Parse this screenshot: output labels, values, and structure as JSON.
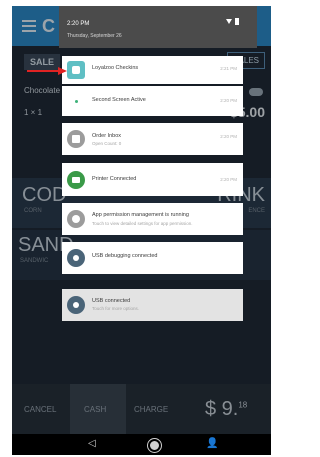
{
  "app": {
    "letter": "C",
    "more": "⋮",
    "sale_label": "SALE",
    "sales_button": "SALES",
    "item_name": "Chocolate",
    "qty_text": "1  ×  1",
    "price": "$5.00",
    "tile_1": "COD",
    "tile_1_sub": "CORN",
    "tile_2": "SAND",
    "tile_2_sub": "SANDWIC",
    "tile_3": "RINK",
    "tile_3_sub": "ENCE",
    "bottom": {
      "cancel": "CANCEL",
      "cash": "CASH",
      "charge": "CHARGE",
      "total_main": "$ 9.",
      "total_cents": "18"
    }
  },
  "nav": {
    "back": "◁",
    "person": "👤"
  },
  "shade": {
    "time": "2:20 PM",
    "date": "Thursday, September 26",
    "notifications": [
      {
        "title": "Loyalzoo Checkins",
        "subtitle": "",
        "time": "2:21 PM",
        "icon_color": "#5fbfc4",
        "icon": "loyalty-app-icon"
      },
      {
        "title": "Second Screen Active",
        "subtitle": "",
        "time": "2:20 PM",
        "icon_color": "#ffffff",
        "icon": "dot-icon"
      },
      {
        "title": "Order Inbox",
        "subtitle": "Open Count: 0",
        "time": "2:20 PM",
        "icon_color": "#9c9c9c",
        "icon": "inbox-icon"
      },
      {
        "title": "Printer Connected",
        "subtitle": "",
        "time": "2:20 PM",
        "icon_color": "#3a9a48",
        "icon": "printer-icon"
      },
      {
        "title": "App permission management is running",
        "subtitle": "Touch to view detailed settings for app permission.",
        "time": "",
        "icon_color": "#9c9c9c",
        "icon": "settings-icon"
      },
      {
        "title": "USB debugging connected",
        "subtitle": "",
        "time": "",
        "icon_color": "#4a6478",
        "icon": "android-icon"
      },
      {
        "title": "USB connected",
        "subtitle": "Touch for more options.",
        "time": "",
        "icon_color": "#4a6478",
        "icon": "usb-icon"
      }
    ]
  },
  "colors": {
    "annotation_arrow": "#e02323",
    "app_header": "#2c89c9",
    "shade_header": "#4b4b4b"
  }
}
